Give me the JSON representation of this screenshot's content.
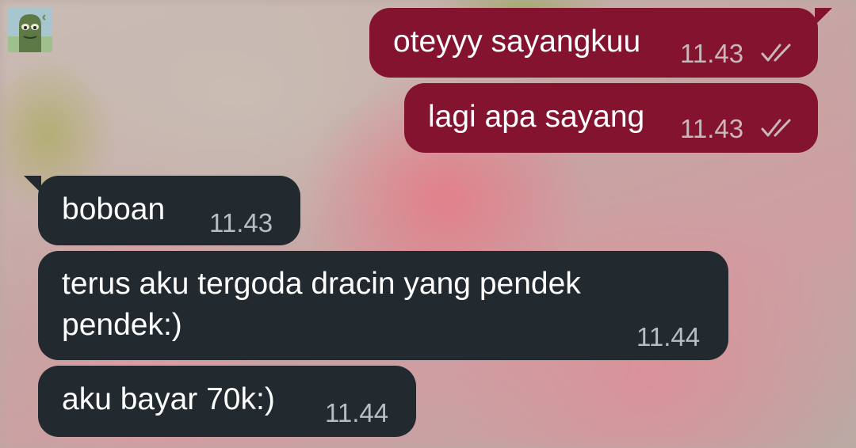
{
  "contact": {
    "avatar_icon": "alien-avatar-icon"
  },
  "colors": {
    "outgoing_bubble": "#841330",
    "incoming_bubble": "#222a2f",
    "text": "#ffffff"
  },
  "messages": [
    {
      "direction": "outgoing",
      "text": "oteyyy sayangkuu",
      "time": "11.43",
      "status": "read"
    },
    {
      "direction": "outgoing",
      "text": "lagi apa sayang",
      "time": "11.43",
      "status": "read"
    },
    {
      "direction": "incoming",
      "text": "boboan",
      "time": "11.43"
    },
    {
      "direction": "incoming",
      "text_line1": "terus aku tergoda dracin yang pendek",
      "text_line2": "pendek:)",
      "time": "11.44"
    },
    {
      "direction": "incoming",
      "text": "aku bayar 70k:)",
      "time": "11.44"
    }
  ]
}
